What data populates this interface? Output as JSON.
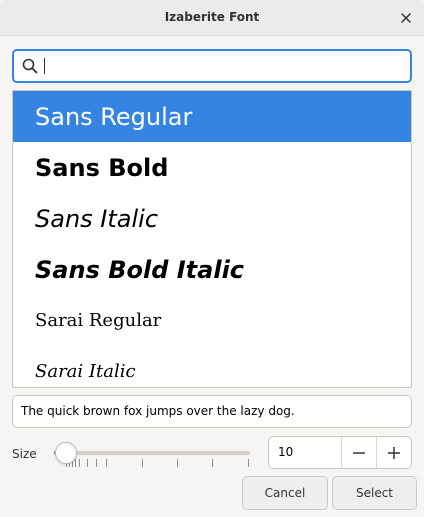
{
  "window": {
    "title": "Izaberite Font"
  },
  "search": {
    "value": ""
  },
  "fonts": [
    {
      "label": "Sans Regular",
      "selected": true
    },
    {
      "label": "Sans Bold",
      "selected": false
    },
    {
      "label": "Sans Italic",
      "selected": false
    },
    {
      "label": "Sans Bold Italic",
      "selected": false
    },
    {
      "label": "Sarai Regular",
      "selected": false
    },
    {
      "label": "Sarai Italic",
      "selected": false
    }
  ],
  "preview": {
    "text": "The quick brown fox jumps over the lazy dog."
  },
  "size": {
    "label": "Size",
    "value": "10",
    "slider_fraction": 0.06
  },
  "buttons": {
    "cancel": "Cancel",
    "select": "Select"
  },
  "icons": {
    "search": "search-icon",
    "close": "close-icon",
    "minus": "minus-icon",
    "plus": "plus-icon"
  },
  "colors": {
    "accent": "#3584e4",
    "selected_text": "#ffffff"
  }
}
